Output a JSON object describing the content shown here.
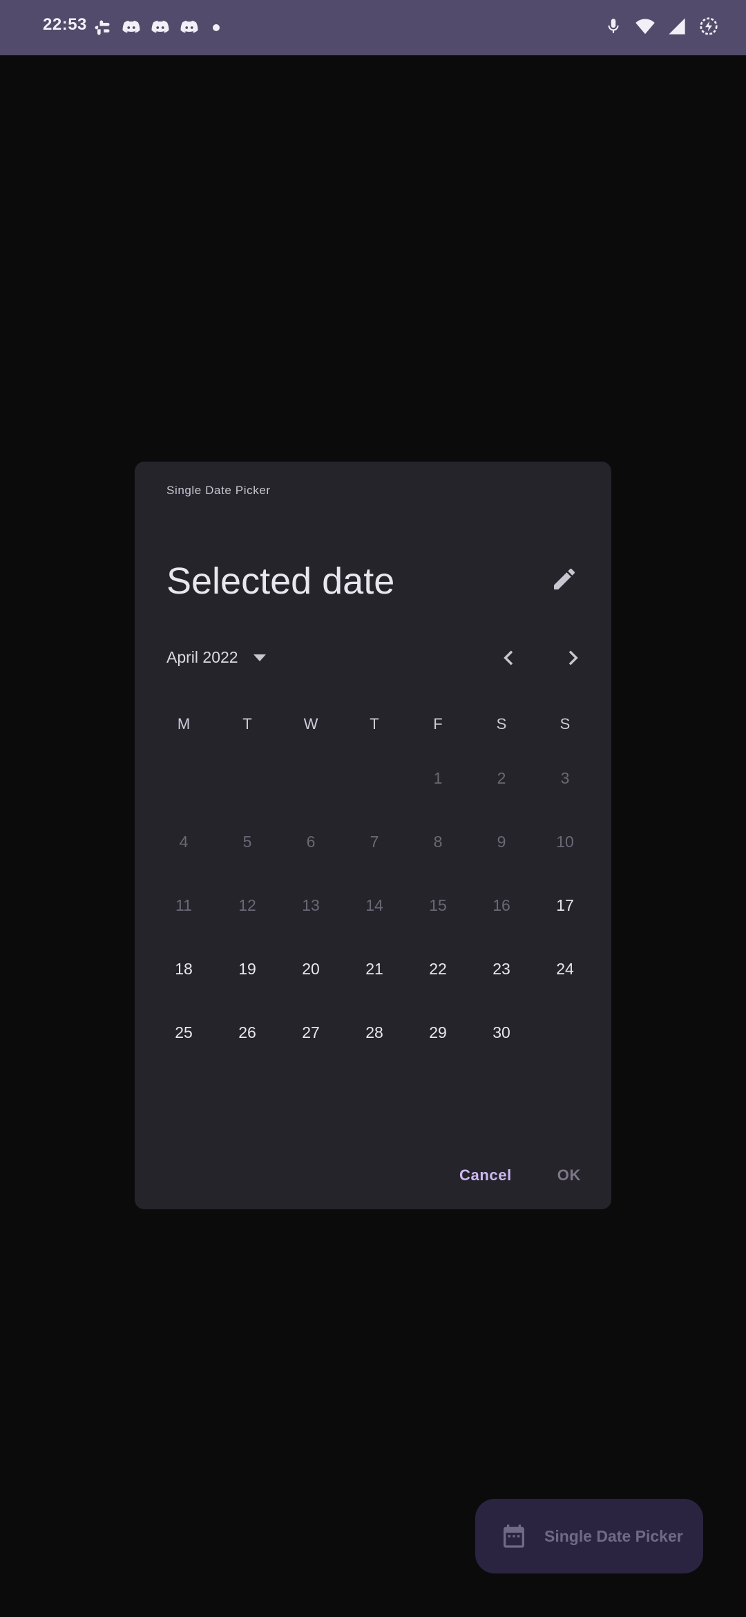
{
  "status_bar": {
    "time": "22:53",
    "left_icons": [
      "slack-icon",
      "discord-icon",
      "discord-icon",
      "discord-icon",
      "more-notifications-dot"
    ],
    "right_icons": [
      "mic-icon",
      "wifi-icon",
      "signal-icon",
      "battery-saver-icon"
    ]
  },
  "dialog": {
    "header_label": "Single Date Picker",
    "title": "Selected date",
    "month_year": "April 2022",
    "weekdays": [
      "M",
      "T",
      "W",
      "T",
      "F",
      "S",
      "S"
    ],
    "days": [
      {
        "label": "",
        "state": "empty"
      },
      {
        "label": "",
        "state": "empty"
      },
      {
        "label": "",
        "state": "empty"
      },
      {
        "label": "",
        "state": "empty"
      },
      {
        "label": "1",
        "state": "disabled"
      },
      {
        "label": "2",
        "state": "disabled"
      },
      {
        "label": "3",
        "state": "disabled"
      },
      {
        "label": "4",
        "state": "disabled"
      },
      {
        "label": "5",
        "state": "disabled"
      },
      {
        "label": "6",
        "state": "disabled"
      },
      {
        "label": "7",
        "state": "disabled"
      },
      {
        "label": "8",
        "state": "disabled"
      },
      {
        "label": "9",
        "state": "disabled"
      },
      {
        "label": "10",
        "state": "disabled"
      },
      {
        "label": "11",
        "state": "disabled"
      },
      {
        "label": "12",
        "state": "disabled"
      },
      {
        "label": "13",
        "state": "disabled"
      },
      {
        "label": "14",
        "state": "disabled"
      },
      {
        "label": "15",
        "state": "disabled"
      },
      {
        "label": "16",
        "state": "disabled"
      },
      {
        "label": "17",
        "state": "enabled"
      },
      {
        "label": "18",
        "state": "enabled"
      },
      {
        "label": "19",
        "state": "enabled"
      },
      {
        "label": "20",
        "state": "enabled"
      },
      {
        "label": "21",
        "state": "enabled"
      },
      {
        "label": "22",
        "state": "enabled"
      },
      {
        "label": "23",
        "state": "enabled"
      },
      {
        "label": "24",
        "state": "enabled"
      },
      {
        "label": "25",
        "state": "enabled"
      },
      {
        "label": "26",
        "state": "enabled"
      },
      {
        "label": "27",
        "state": "enabled"
      },
      {
        "label": "28",
        "state": "enabled"
      },
      {
        "label": "29",
        "state": "enabled"
      },
      {
        "label": "30",
        "state": "enabled"
      }
    ],
    "cancel_label": "Cancel",
    "ok_label": "OK",
    "icons": {
      "edit": "pencil-icon",
      "dropdown": "dropdown-arrow-icon",
      "prev": "chevron-left-icon",
      "next": "chevron-right-icon"
    }
  },
  "fab": {
    "label": "Single Date Picker",
    "icon": "calendar-icon"
  },
  "colors": {
    "status_bar": "#524b6b",
    "dialog_bg": "#25242b",
    "accent": "#cdb8f2",
    "fab_bg": "#2b2440"
  }
}
